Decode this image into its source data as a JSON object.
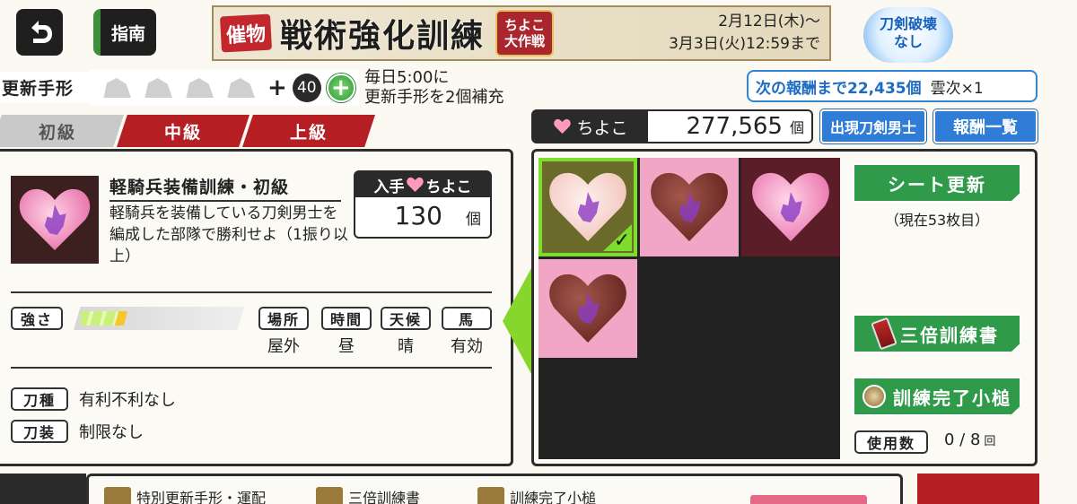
{
  "topbar": {
    "guide_label": "指南",
    "banner": {
      "tag": "催物",
      "title": "戦術強化訓練",
      "sub_line1": "ちよこ",
      "sub_line2": "大作戦",
      "date_line1": "2月12日(木)～",
      "date_line2": "3月3日(火)12:59まで"
    },
    "blade_badge_line1": "刀剣破壊",
    "blade_badge_line2": "なし"
  },
  "renewal": {
    "label": "更新手形",
    "count": "40",
    "note_line1": "毎日5:00に",
    "note_line2": "更新手形を2個補充"
  },
  "next_reward": {
    "prefix": "次の報酬まで22,435個",
    "item": "雲次×1"
  },
  "tabs": [
    {
      "label": "初級",
      "state": "inactive"
    },
    {
      "label": "中級",
      "state": "active"
    },
    {
      "label": "上級",
      "state": "active"
    }
  ],
  "chocolate": {
    "label": "ちよこ",
    "amount": "277,565",
    "unit": "個"
  },
  "buttons": {
    "appearing_blades": "出現刀剣男士",
    "reward_list": "報酬一覧",
    "sheet_refresh": "シート更新",
    "triple_book": "三倍訓練書",
    "completion_hammer": "訓練完了小槌"
  },
  "mission": {
    "title": "軽騎兵装備訓練・初級",
    "description": "軽騎兵を装備している刀剣男士を編成した部隊で勝利せよ（1振り以上）",
    "reward_head_prefix": "入手",
    "reward_head_suffix": "ちよこ",
    "reward_amount": "130",
    "reward_unit": "個",
    "strength_label": "強さ",
    "strength_level": 0.25,
    "conditions": [
      {
        "label": "場所",
        "value": "屋外"
      },
      {
        "label": "時間",
        "value": "昼"
      },
      {
        "label": "天候",
        "value": "晴"
      },
      {
        "label": "馬",
        "value": "有効"
      }
    ],
    "sword_type_label": "刀種",
    "sword_type_value": "有利不利なし",
    "equip_label": "刀装",
    "equip_value": "制限なし"
  },
  "sheet": {
    "note": "（現在53枚目）",
    "cells": [
      "light-selected",
      "choco",
      "pink",
      "choco",
      "empty",
      "empty",
      "empty",
      "empty",
      "empty"
    ]
  },
  "usage": {
    "label": "使用数",
    "value": "0 / 8",
    "unit": "回"
  },
  "bottom": {
    "items": [
      "特別更新手形・運配",
      "三倍訓練書",
      "訓練完了小槌"
    ]
  },
  "colors": {
    "accent_red": "#b51f23",
    "accent_green": "#2f9a4a",
    "accent_blue": "#2f7dd6",
    "highlight_green": "#7edc2c"
  }
}
